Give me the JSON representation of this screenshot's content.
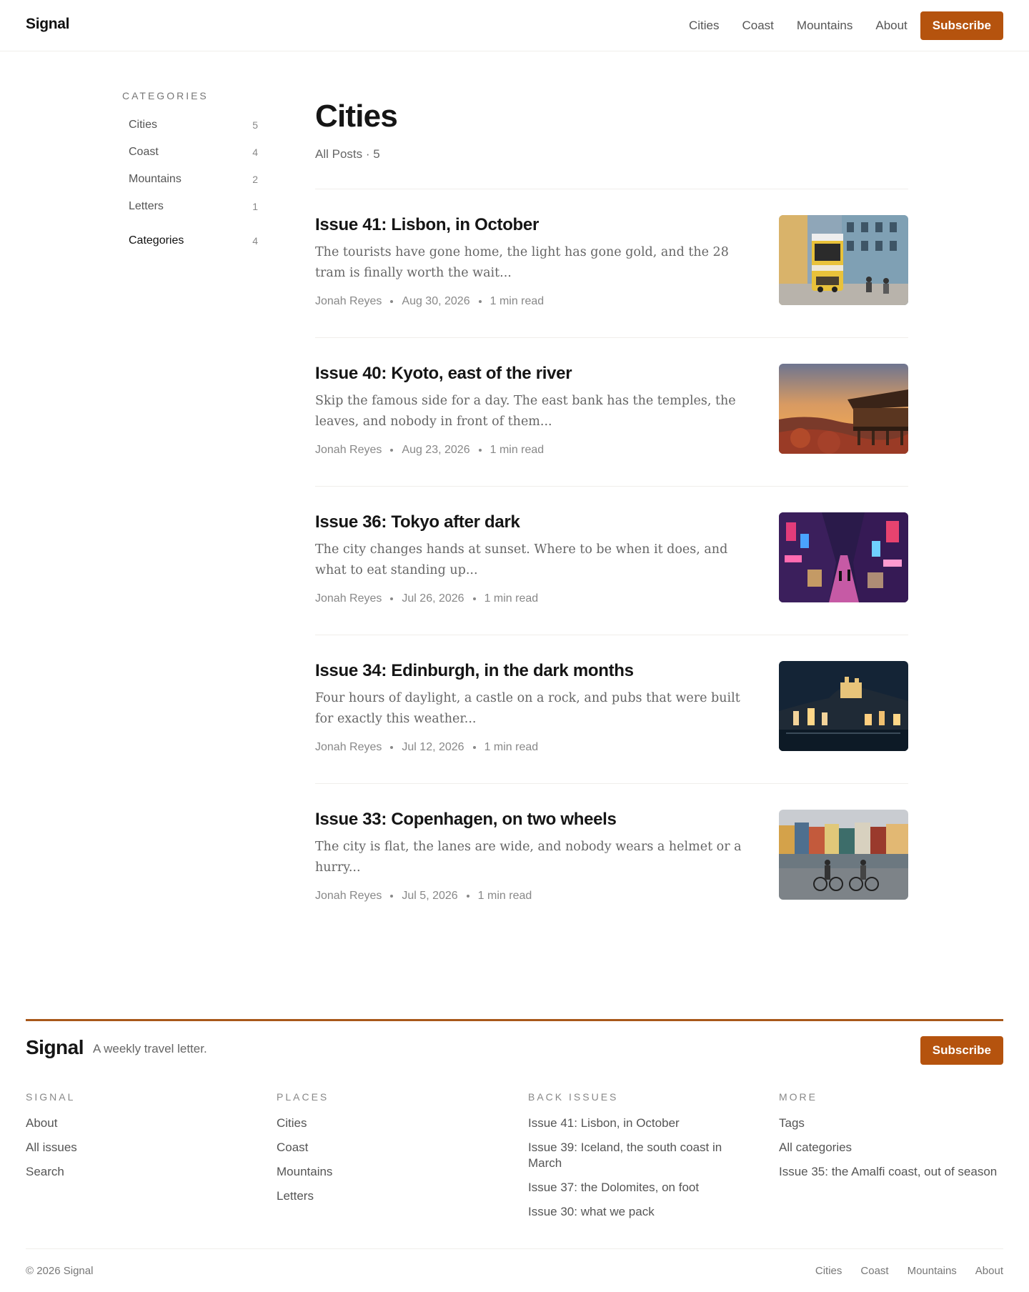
{
  "header": {
    "logo": "Signal",
    "nav": [
      "Cities",
      "Coast",
      "Mountains",
      "About"
    ],
    "subscribe_label": "Subscribe"
  },
  "sidebar": {
    "heading": "CATEGORIES",
    "items": [
      {
        "label": "Cities",
        "count": "5"
      },
      {
        "label": "Coast",
        "count": "4"
      },
      {
        "label": "Mountains",
        "count": "2"
      },
      {
        "label": "Letters",
        "count": "1"
      }
    ],
    "active": {
      "label": "Categories",
      "count": "4"
    }
  },
  "main": {
    "title": "Cities",
    "subtitle": "All Posts · 5",
    "posts": [
      {
        "title": "Issue 41: Lisbon, in October",
        "excerpt": "The tourists have gone home, the light has gone gold, and the 28 tram is finally worth the wait...",
        "author": "Jonah Reyes",
        "date": "Aug 30, 2026",
        "read": "1 min read",
        "image": "lisbon-tram-photo"
      },
      {
        "title": "Issue 40: Kyoto, east of the river",
        "excerpt": "Skip the famous side for a day. The east bank has the temples, the leaves, and nobody in front of them...",
        "author": "Jonah Reyes",
        "date": "Aug 23, 2026",
        "read": "1 min read",
        "image": "kyoto-temple-photo"
      },
      {
        "title": "Issue 36: Tokyo after dark",
        "excerpt": "The city changes hands at sunset. Where to be when it does, and what to eat standing up...",
        "author": "Jonah Reyes",
        "date": "Jul 26, 2026",
        "read": "1 min read",
        "image": "tokyo-neon-street-photo"
      },
      {
        "title": "Issue 34: Edinburgh, in the dark months",
        "excerpt": "Four hours of daylight, a castle on a rock, and pubs that were built for exactly this weather...",
        "author": "Jonah Reyes",
        "date": "Jul 12, 2026",
        "read": "1 min read",
        "image": "edinburgh-night-photo"
      },
      {
        "title": "Issue 33: Copenhagen, on two wheels",
        "excerpt": "The city is flat, the lanes are wide, and nobody wears a helmet or a hurry...",
        "author": "Jonah Reyes",
        "date": "Jul 5, 2026",
        "read": "1 min read",
        "image": "copenhagen-bikes-photo"
      }
    ]
  },
  "footer": {
    "logo": "Signal",
    "tagline": "A weekly travel letter.",
    "subscribe_label": "Subscribe",
    "columns": [
      {
        "title": "SIGNAL",
        "links": [
          "About",
          "All issues",
          "Search"
        ]
      },
      {
        "title": "PLACES",
        "links": [
          "Cities",
          "Coast",
          "Mountains",
          "Letters"
        ]
      },
      {
        "title": "BACK ISSUES",
        "links": [
          "Issue 41: Lisbon, in October",
          "Issue 39: Iceland, the south coast in March",
          "Issue 37: the Dolomites, on foot",
          "Issue 30: what we pack"
        ]
      },
      {
        "title": "MORE",
        "links": [
          "Tags",
          "All categories",
          "Issue 35: the Amalfi coast, out of season"
        ]
      }
    ],
    "copyright": "© 2026 Signal",
    "bottom_nav": [
      "Cities",
      "Coast",
      "Mountains",
      "About"
    ]
  },
  "colors": {
    "accent": "#b5530e",
    "footer_rule": "#a8581a"
  }
}
